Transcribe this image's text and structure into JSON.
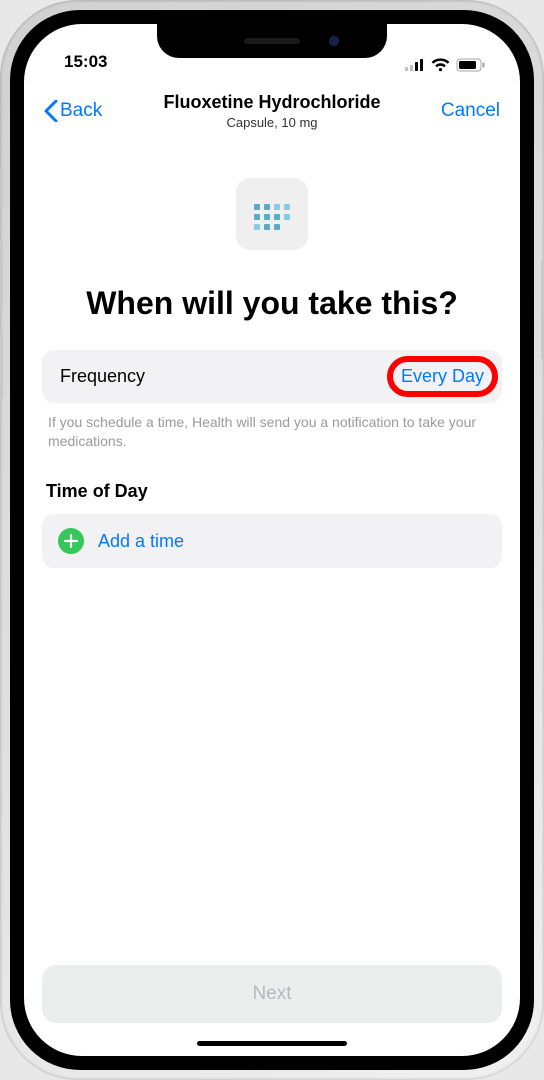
{
  "status": {
    "time": "15:03"
  },
  "nav": {
    "back_label": "Back",
    "title": "Fluoxetine Hydrochloride",
    "subtitle": "Capsule, 10 mg",
    "cancel_label": "Cancel"
  },
  "heading": "When will you take this?",
  "frequency": {
    "label": "Frequency",
    "value": "Every Day"
  },
  "helper_text": "If you schedule a time, Health will send you a notification to take your medications.",
  "time_section": {
    "heading": "Time of Day",
    "add_label": "Add a time"
  },
  "footer": {
    "next_label": "Next"
  }
}
